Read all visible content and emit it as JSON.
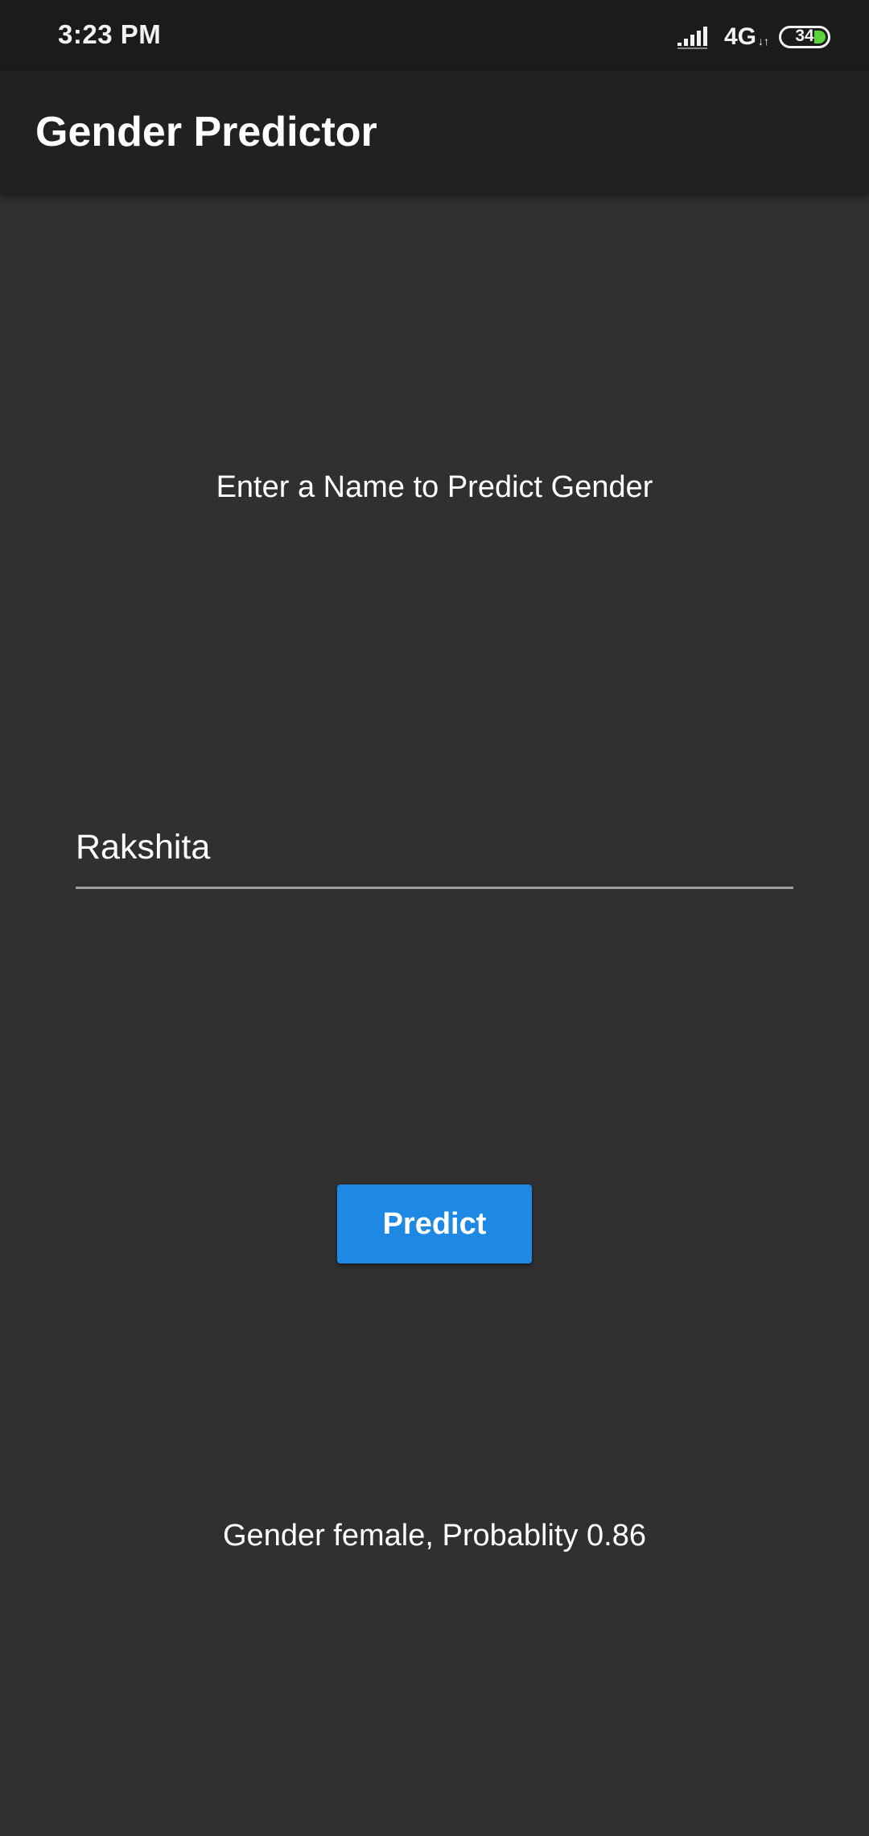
{
  "status_bar": {
    "time": "3:23 PM",
    "network": "4G",
    "network_arrows": "↓↑",
    "battery_level": "34",
    "battery_color": "#5ad43a"
  },
  "app_bar": {
    "title": "Gender Predictor"
  },
  "main": {
    "prompt": "Enter a Name to Predict Gender",
    "name_input_value": "Rakshita",
    "predict_label": "Predict",
    "result": "Gender female, Probablity 0.86"
  },
  "colors": {
    "background": "#303030",
    "app_bar": "#212121",
    "status_bar": "#1b1b1b",
    "accent": "#1e88e5"
  },
  "icons": {
    "signal": "cell-signal-icon",
    "battery": "battery-icon"
  }
}
